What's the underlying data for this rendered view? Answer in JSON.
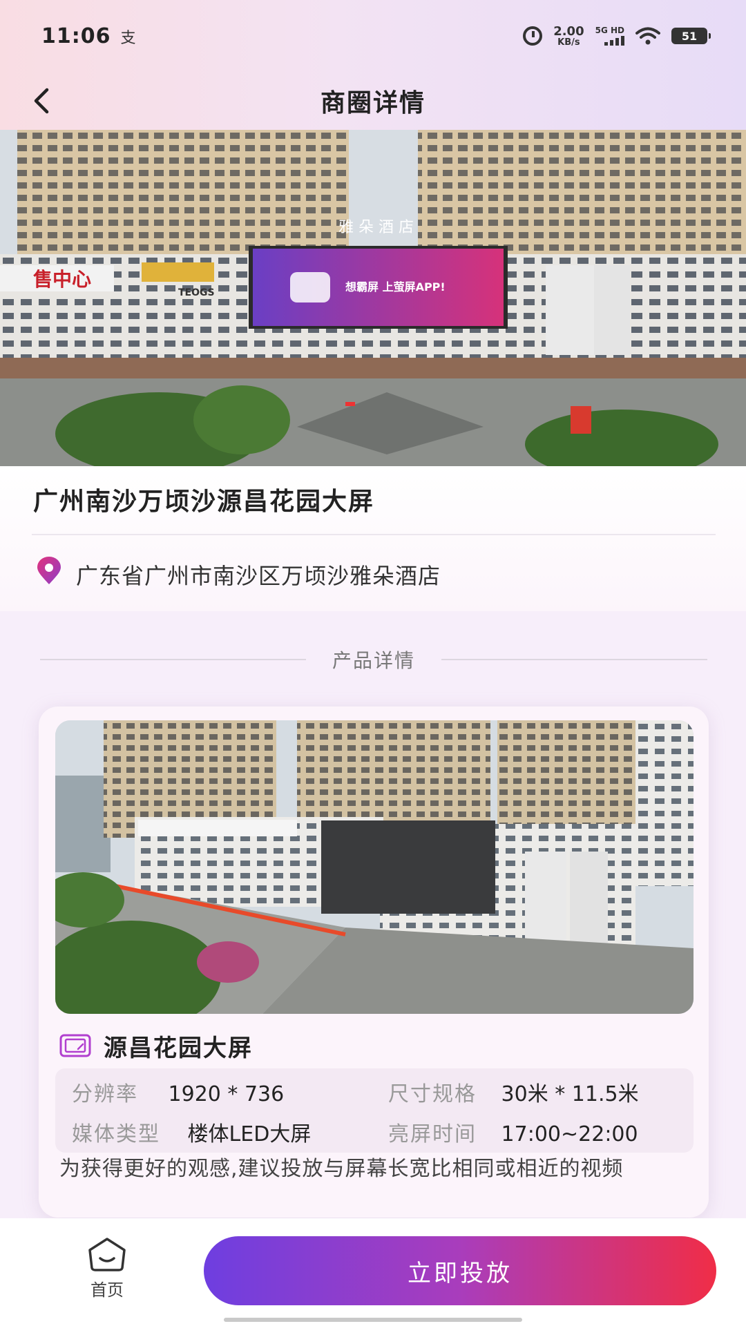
{
  "status_bar": {
    "time": "11:06",
    "carrier_glyph": "支",
    "net_speed_value": "2.00",
    "net_speed_unit": "KB/s",
    "signal_label": "5G HD",
    "battery": "51",
    "icons": [
      "alarm-icon",
      "signal-icon",
      "wifi-icon",
      "battery-icon"
    ]
  },
  "header": {
    "title": "商圈详情",
    "back_icon": "chevron-left-icon"
  },
  "hero": {
    "billboard_text": "想霸屏 上萤屏APP!",
    "building_sign": "雅 朵 酒 店",
    "left_sign": "售中心",
    "store_sign": "TEOGS"
  },
  "info": {
    "place_title": "广州南沙万顷沙源昌花园大屏",
    "address": "广东省广州市南沙区万顷沙雅朵酒店",
    "address_icon": "location-pin-icon"
  },
  "product_section": {
    "heading": "产品详情"
  },
  "product": {
    "screen_name": "源昌花园大屏",
    "screen_icon": "screen-icon",
    "specs": [
      {
        "key": "分辨率",
        "value": "1920 * 736"
      },
      {
        "key": "尺寸规格",
        "value": "30米 * 11.5米"
      },
      {
        "key": "媒体类型",
        "value": "楼体LED大屏"
      },
      {
        "key": "亮屏时间",
        "value": "17:00~22:00"
      }
    ],
    "note": "为获得更好的观感,建议投放与屏幕长宽比相同或相近的视频"
  },
  "bottom_bar": {
    "home_label": "首页",
    "home_icon": "home-icon",
    "cta_label": "立即投放"
  },
  "colors": {
    "cta_start": "#6e3ee0",
    "cta_end": "#f02d47",
    "pin_icon": "#c6359c"
  }
}
